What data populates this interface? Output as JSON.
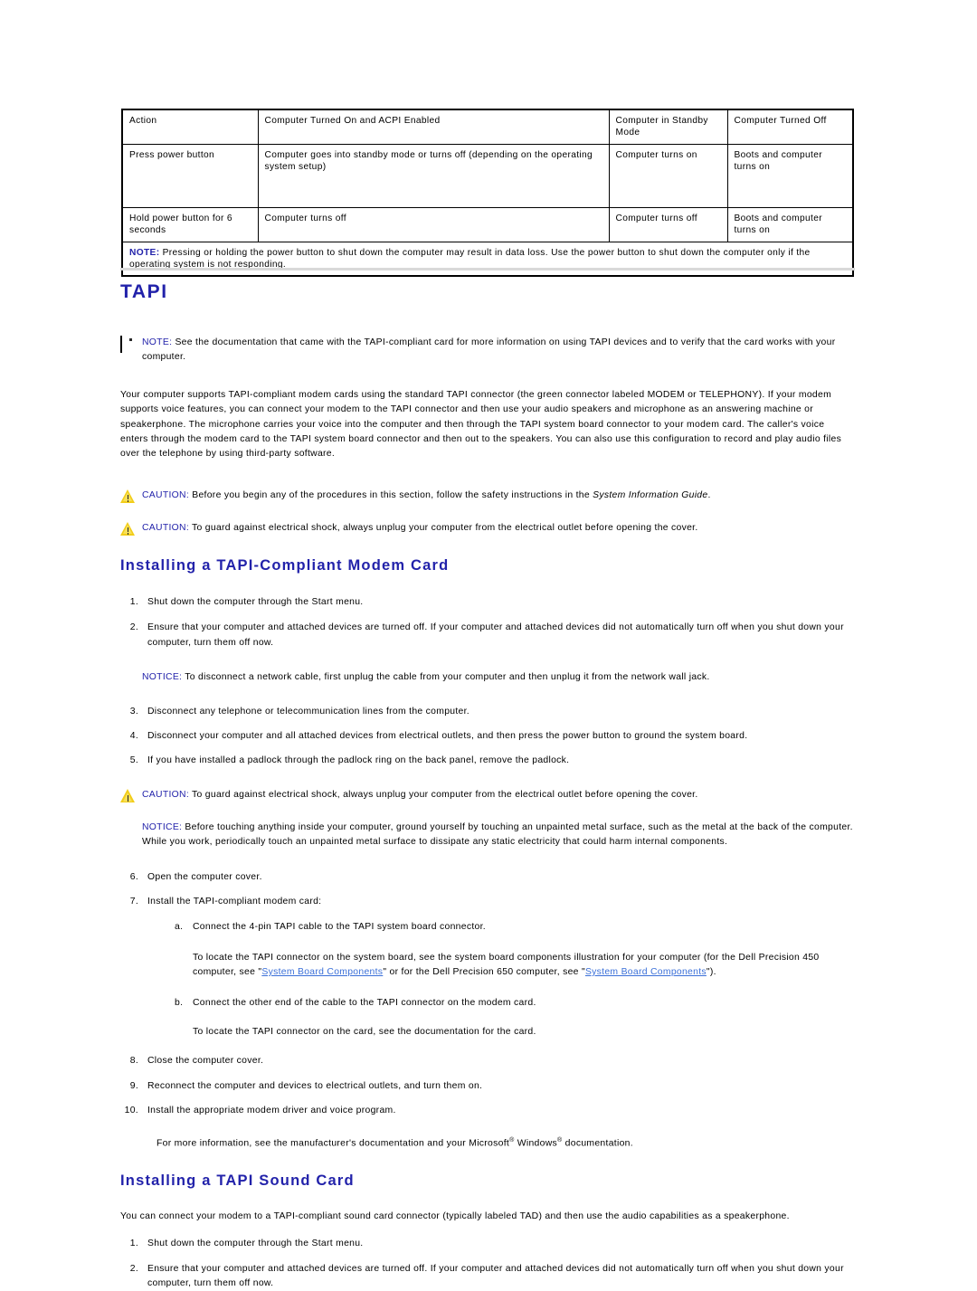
{
  "power_table": {
    "headers": [
      "Action",
      "Computer Turned On and ACPI Enabled",
      "Computer in Standby Mode",
      "Computer Turned Off"
    ],
    "rows": [
      {
        "action": "Press power button",
        "on_acpi": "Computer goes into standby mode or turns off (depending on the operating system setup)",
        "standby": "Computer turns on",
        "off": "Boots and computer turns on"
      },
      {
        "action": "Hold power button for 6 seconds",
        "on_acpi": "Computer turns off",
        "standby": "Computer turns off",
        "off": "Boots and computer turns on"
      }
    ],
    "note_label": "NOTE:",
    "note_text": " Pressing or holding the power button to shut down the computer may result in data loss. Use the power button to shut down the computer only if the operating system is not responding."
  },
  "tapi": {
    "heading": "TAPI",
    "note": {
      "label": "NOTE:",
      "text": " See the documentation that came with the TAPI-compliant card for more information on using TAPI devices and to verify that the card works with your computer."
    },
    "intro": " Your computer supports TAPI-compliant modem cards using the standard TAPI connector (the green connector labeled MODEM or TELEPHONY). If your modem supports voice features, you can connect your modem to the TAPI connector and then use your audio speakers and microphone as an answering machine or speakerphone. The microphone carries your voice into the computer and then through the TAPI system board connector to your modem card. The caller's voice enters through the modem card to the TAPI system board connector and then out to the speakers. You can also use this configuration to record and play audio files over the telephone by using third-party software.",
    "caution1": {
      "label": "CAUTION:",
      "text_before": " Before you begin any of the procedures in this section, follow the safety instructions in the ",
      "italic": "System Information Guide",
      "text_after": "."
    },
    "caution2": {
      "label": "CAUTION:",
      "text": " To guard against electrical shock, always unplug your computer from the electrical outlet before opening the cover."
    }
  },
  "modem_section": {
    "heading": "Installing a TAPI-Compliant Modem Card",
    "steps_1_2": [
      {
        "num": "1.",
        "text": "Shut down the computer through the Start menu."
      },
      {
        "num": "2.",
        "text": "Ensure that your computer and attached devices are turned off. If your computer and attached devices did not automatically turn off when you shut down your computer, turn them off now."
      }
    ],
    "notice1": {
      "label": "NOTICE:",
      "text": " To disconnect a network cable, first unplug the cable from your computer and then unplug it from the network wall jack."
    },
    "steps_3_5": [
      {
        "num": "3.",
        "text": "Disconnect any telephone or telecommunication lines from the computer."
      },
      {
        "num": "4.",
        "text": "Disconnect your computer and all attached devices from electrical outlets, and then press the power button to ground the system board."
      },
      {
        "num": "5.",
        "text": "If you have installed a padlock through the padlock ring on the back panel, remove the padlock."
      }
    ],
    "caution3": {
      "label": "CAUTION:",
      "text": " To guard against electrical shock, always unplug your computer from the electrical outlet before opening the cover."
    },
    "notice2": {
      "label": "NOTICE:",
      "text": " Before touching anything inside your computer, ground yourself by touching an unpainted metal surface, such as the metal at the back of the computer. While you work, periodically touch an unpainted metal surface to dissipate any static electricity that could harm internal components."
    },
    "step6": {
      "num": "6.",
      "text": "Open the computer cover."
    },
    "step7": {
      "num": "7.",
      "text": "Install the TAPI-compliant modem card:"
    },
    "step7a": {
      "num": "a.",
      "text": "Connect the 4-pin TAPI cable to the TAPI system board connector."
    },
    "step7a_note": {
      "part1": "To locate the TAPI connector on the system board, see the system board components illustration for your computer (for the Dell Precision 450 computer, see \"",
      "link1": "System Board Components",
      "part2": "\" or for the Dell Precision 650 computer, see \"",
      "link2": "System Board Components",
      "part3": "\")."
    },
    "step7b": {
      "num": "b.",
      "text": "Connect the other end of the cable to the TAPI connector on the modem card."
    },
    "step7b_note": "To locate the TAPI connector on the card, see the documentation for the card.",
    "steps_8_10": [
      {
        "num": "8.",
        "text": "Close the computer cover."
      },
      {
        "num": "9.",
        "text": "Reconnect the computer and devices to electrical outlets, and turn them on."
      },
      {
        "num": "10.",
        "text": "Install the appropriate modem driver and voice program."
      }
    ],
    "more_info": {
      "part1": "For more information, see the manufacturer's documentation and your Microsoft",
      "sup1": "®",
      "part2": " Windows",
      "sup2": "®",
      "part3": " documentation."
    }
  },
  "sound_section": {
    "heading": "Installing a TAPI Sound Card",
    "intro": "You can connect your modem to a TAPI-compliant sound card connector (typically labeled TAD) and then use the audio capabilities as a speakerphone.",
    "steps": [
      {
        "num": "1.",
        "text": "Shut down the computer through the Start menu."
      },
      {
        "num": "2.",
        "text": "Ensure that your computer and attached devices are turned off. If your computer and attached devices did not automatically turn off when you shut down your computer, turn them off now."
      }
    ]
  }
}
